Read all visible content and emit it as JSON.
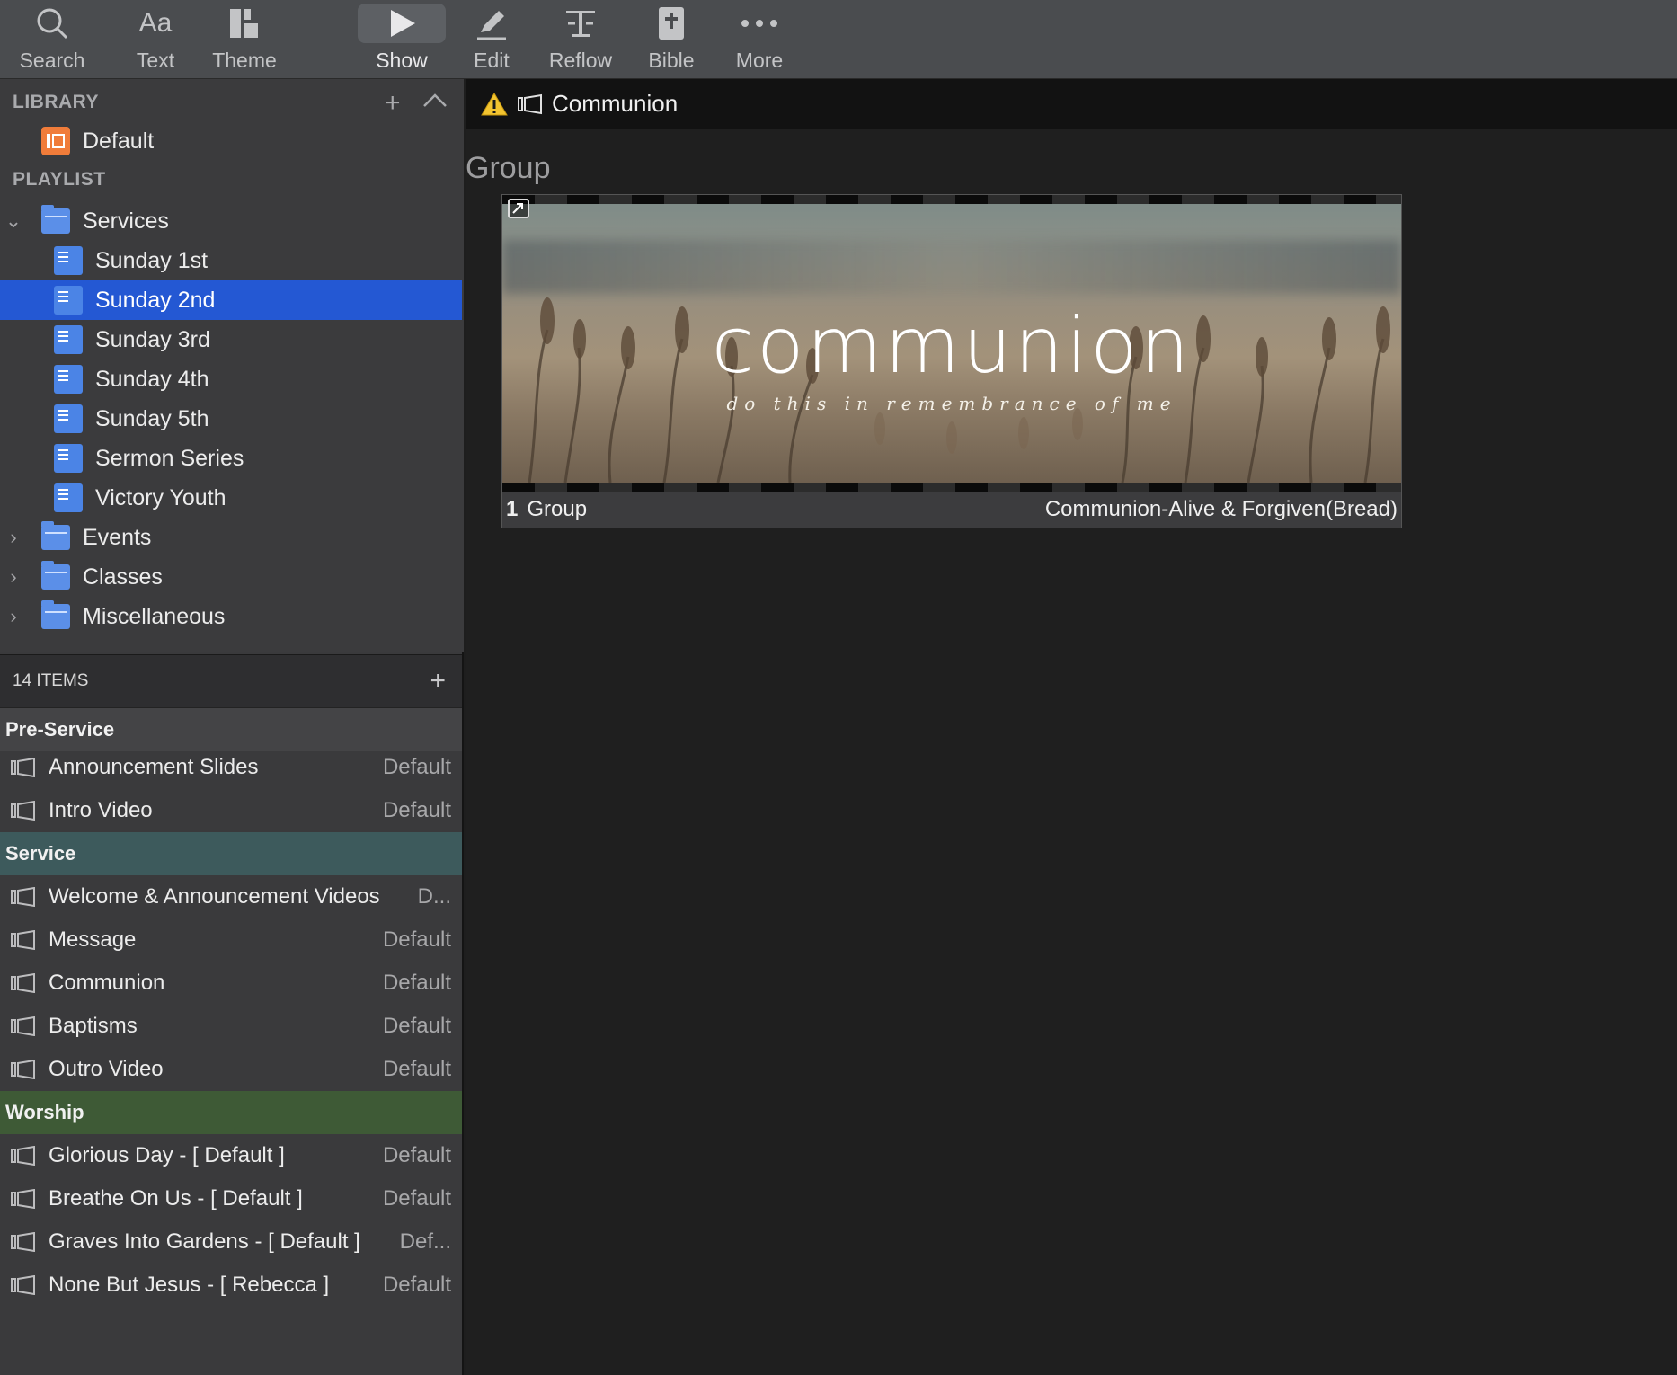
{
  "toolbar": {
    "items": [
      {
        "label": "Search",
        "icon": "search-icon"
      },
      {
        "label": "Text",
        "icon": "text-icon"
      },
      {
        "label": "Theme",
        "icon": "theme-icon"
      },
      {
        "label": "Show",
        "icon": "play-icon"
      },
      {
        "label": "Edit",
        "icon": "pencil-icon"
      },
      {
        "label": "Reflow",
        "icon": "reflow-icon"
      },
      {
        "label": "Bible",
        "icon": "bible-icon"
      },
      {
        "label": "More",
        "icon": "more-icon"
      }
    ],
    "text_glyph": "Aa"
  },
  "library": {
    "header": "LIBRARY",
    "items": [
      {
        "label": "Default"
      }
    ]
  },
  "playlist": {
    "header": "PLAYLIST",
    "folders": [
      {
        "label": "Services",
        "expanded": true
      },
      {
        "label": "Events",
        "expanded": false
      },
      {
        "label": "Classes",
        "expanded": false
      },
      {
        "label": "Miscellaneous",
        "expanded": false
      }
    ],
    "services_children": [
      {
        "label": "Sunday 1st"
      },
      {
        "label": "Sunday 2nd",
        "selected": true
      },
      {
        "label": "Sunday 3rd"
      },
      {
        "label": "Sunday 4th"
      },
      {
        "label": "Sunday 5th"
      },
      {
        "label": "Sermon Series"
      },
      {
        "label": "Victory Youth"
      }
    ]
  },
  "items_panel": {
    "count_label": "14 ITEMS",
    "groups": [
      {
        "name": "Pre-Service",
        "color": "#444446",
        "items": [
          {
            "title": "Announcement Slides",
            "theme": "Default"
          },
          {
            "title": "Intro Video",
            "theme": "Default"
          }
        ]
      },
      {
        "name": "Service",
        "color": "#3d5a5c",
        "items": [
          {
            "title": "Welcome & Announcement Videos",
            "theme": "D..."
          },
          {
            "title": "Message",
            "theme": "Default"
          },
          {
            "title": "Communion",
            "theme": "Default"
          },
          {
            "title": "Baptisms",
            "theme": "Default"
          },
          {
            "title": "Outro Video",
            "theme": "Default"
          }
        ]
      },
      {
        "name": "Worship",
        "color": "#3e5a36",
        "items": [
          {
            "title": "Glorious Day - [ Default ]",
            "theme": "Default"
          },
          {
            "title": "Breathe On Us - [ Default ]",
            "theme": "Default"
          },
          {
            "title": "Graves Into Gardens - [ Default ]",
            "theme": "Def..."
          },
          {
            "title": "None But Jesus - [ Rebecca ]",
            "theme": "Default"
          }
        ]
      }
    ]
  },
  "document": {
    "title": "Communion",
    "group_heading": "Group",
    "slide": {
      "number": "1",
      "group": "Group",
      "title_text": "communion",
      "subtitle_text": "do this in remembrance of me",
      "media_name": "Communion-Alive & Forgiven(Bread)"
    }
  },
  "colors": {
    "selection": "#2458d3",
    "folder_blue": "#5b8fe8",
    "warning": "#f3c430"
  }
}
